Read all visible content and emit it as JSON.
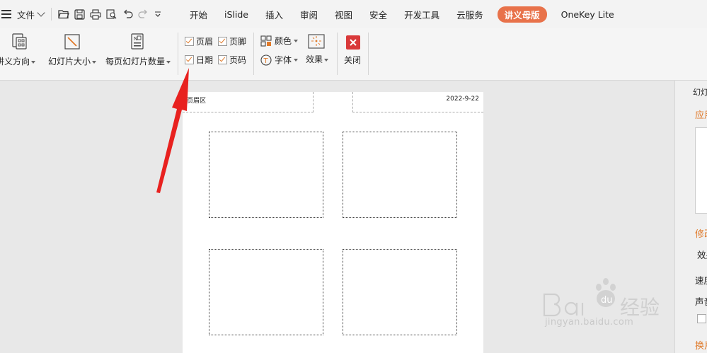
{
  "menubar": {
    "file_label": "文件",
    "tabs": [
      "开始",
      "iSlide",
      "插入",
      "审阅",
      "视图",
      "安全",
      "开发工具",
      "云服务",
      "讲义母版",
      "OneKey Lite"
    ],
    "active_tab": "讲义母版",
    "accent": "#e8724a"
  },
  "ribbon": {
    "orientation_label": "讲义方向",
    "slide_size_label": "幻灯片大小",
    "per_page_label": "每页幻灯片数量",
    "checkboxes": {
      "header": "页眉",
      "footer": "页脚",
      "date": "日期",
      "page_number": "页码"
    },
    "colors_label": "颜色",
    "fonts_label": "字体",
    "effects_label": "效果",
    "close_label": "关闭"
  },
  "slide": {
    "header_text": "页眉区",
    "date_text": "2022-9-22"
  },
  "right_panel": {
    "title": "幻灯",
    "apply_label": "应用",
    "modify_label": "修改",
    "effect_label": "效果",
    "speed_label": "速度",
    "sound_label": "声音",
    "change_label": "换片"
  },
  "watermark": {
    "brand": "Bai  经验",
    "url": "jingyan.baidu.com"
  }
}
